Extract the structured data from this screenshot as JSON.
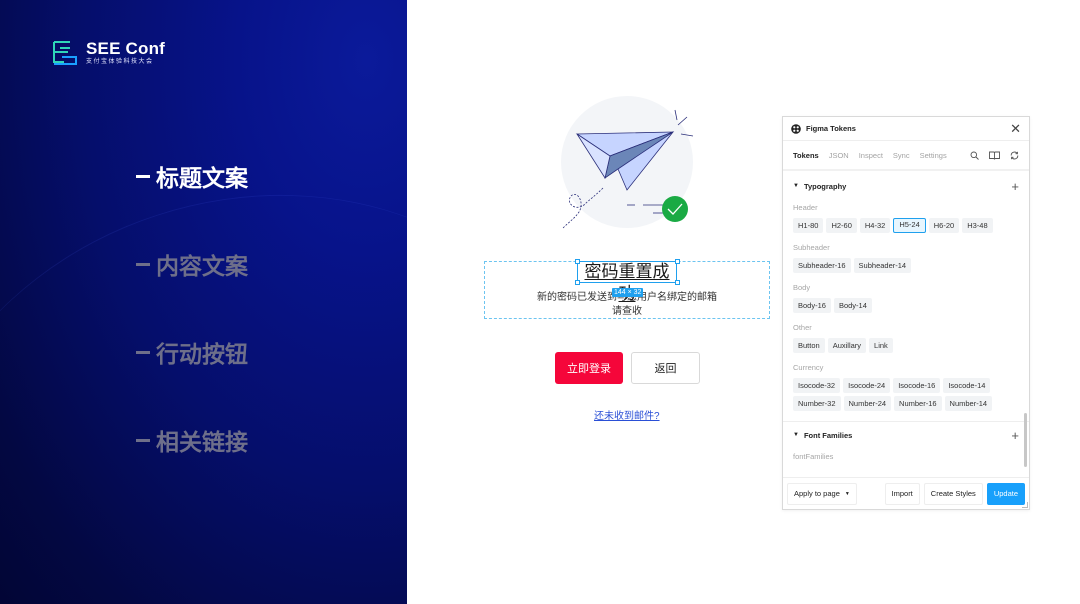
{
  "brand": {
    "name": "SEE Conf",
    "subtitle": "支付宝体验科技大会",
    "accent_teal": "#2fd6b8",
    "accent_blue": "#1aa0ff"
  },
  "nav": {
    "items": [
      {
        "label": "标题文案",
        "active": true
      },
      {
        "label": "内容文案",
        "active": false
      },
      {
        "label": "行动按钮",
        "active": false
      },
      {
        "label": "相关链接",
        "active": false
      }
    ]
  },
  "mock": {
    "title": "密码重置成功",
    "size_badge": "144 × 32",
    "desc_line1": "新的密码已发送到与您用户名绑定的邮箱",
    "desc_line2": "请查收",
    "primary_button": "立即登录",
    "secondary_button": "返回",
    "link": "还未收到邮件?",
    "primary_color": "#f5063a",
    "success_color": "#1aaa44"
  },
  "plugin": {
    "title": "Figma Tokens",
    "tabs": [
      {
        "label": "Tokens",
        "active": true
      },
      {
        "label": "JSON",
        "active": false
      },
      {
        "label": "Inspect",
        "active": false
      },
      {
        "label": "Sync",
        "active": false
      },
      {
        "label": "Settings",
        "active": false
      }
    ],
    "sections": {
      "typography": {
        "label": "Typography",
        "groups": {
          "header": {
            "label": "Header",
            "tokens": [
              "H1-80",
              "H2-60",
              "H4-32",
              "H5-24",
              "H6-20",
              "H3-48"
            ],
            "selected": "H5-24"
          },
          "subheader": {
            "label": "Subheader",
            "tokens": [
              "Subheader-16",
              "Subheader-14"
            ]
          },
          "body": {
            "label": "Body",
            "tokens": [
              "Body-16",
              "Body-14"
            ]
          },
          "other": {
            "label": "Other",
            "tokens": [
              "Button",
              "Auxillary",
              "Link"
            ]
          },
          "currency": {
            "label": "Currency",
            "tokens": [
              "Isocode-32",
              "Isocode-24",
              "Isocode-16",
              "Isocode-14",
              "Number-32",
              "Number-24",
              "Number-16",
              "Number-14"
            ]
          }
        }
      },
      "font_families": {
        "label": "Font Families",
        "group_label": "fontFamilies"
      }
    },
    "footer": {
      "apply": "Apply to page",
      "import": "Import",
      "create_styles": "Create Styles",
      "update": "Update"
    },
    "accent": "#18a0fb"
  }
}
